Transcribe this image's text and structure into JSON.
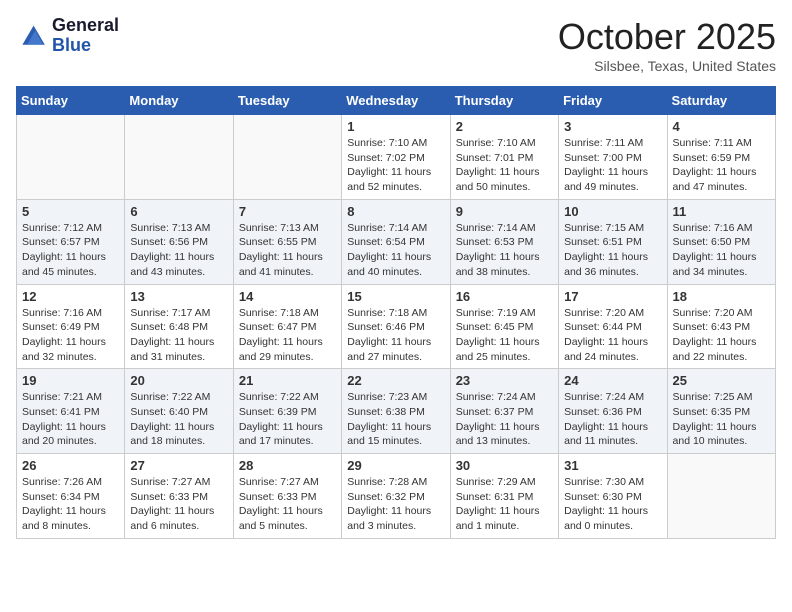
{
  "header": {
    "logo_line1": "General",
    "logo_line2": "Blue",
    "month_title": "October 2025",
    "location": "Silsbee, Texas, United States"
  },
  "days_of_week": [
    "Sunday",
    "Monday",
    "Tuesday",
    "Wednesday",
    "Thursday",
    "Friday",
    "Saturday"
  ],
  "weeks": [
    [
      {
        "day": "",
        "content": ""
      },
      {
        "day": "",
        "content": ""
      },
      {
        "day": "",
        "content": ""
      },
      {
        "day": "1",
        "content": "Sunrise: 7:10 AM\nSunset: 7:02 PM\nDaylight: 11 hours and 52 minutes."
      },
      {
        "day": "2",
        "content": "Sunrise: 7:10 AM\nSunset: 7:01 PM\nDaylight: 11 hours and 50 minutes."
      },
      {
        "day": "3",
        "content": "Sunrise: 7:11 AM\nSunset: 7:00 PM\nDaylight: 11 hours and 49 minutes."
      },
      {
        "day": "4",
        "content": "Sunrise: 7:11 AM\nSunset: 6:59 PM\nDaylight: 11 hours and 47 minutes."
      }
    ],
    [
      {
        "day": "5",
        "content": "Sunrise: 7:12 AM\nSunset: 6:57 PM\nDaylight: 11 hours and 45 minutes."
      },
      {
        "day": "6",
        "content": "Sunrise: 7:13 AM\nSunset: 6:56 PM\nDaylight: 11 hours and 43 minutes."
      },
      {
        "day": "7",
        "content": "Sunrise: 7:13 AM\nSunset: 6:55 PM\nDaylight: 11 hours and 41 minutes."
      },
      {
        "day": "8",
        "content": "Sunrise: 7:14 AM\nSunset: 6:54 PM\nDaylight: 11 hours and 40 minutes."
      },
      {
        "day": "9",
        "content": "Sunrise: 7:14 AM\nSunset: 6:53 PM\nDaylight: 11 hours and 38 minutes."
      },
      {
        "day": "10",
        "content": "Sunrise: 7:15 AM\nSunset: 6:51 PM\nDaylight: 11 hours and 36 minutes."
      },
      {
        "day": "11",
        "content": "Sunrise: 7:16 AM\nSunset: 6:50 PM\nDaylight: 11 hours and 34 minutes."
      }
    ],
    [
      {
        "day": "12",
        "content": "Sunrise: 7:16 AM\nSunset: 6:49 PM\nDaylight: 11 hours and 32 minutes."
      },
      {
        "day": "13",
        "content": "Sunrise: 7:17 AM\nSunset: 6:48 PM\nDaylight: 11 hours and 31 minutes."
      },
      {
        "day": "14",
        "content": "Sunrise: 7:18 AM\nSunset: 6:47 PM\nDaylight: 11 hours and 29 minutes."
      },
      {
        "day": "15",
        "content": "Sunrise: 7:18 AM\nSunset: 6:46 PM\nDaylight: 11 hours and 27 minutes."
      },
      {
        "day": "16",
        "content": "Sunrise: 7:19 AM\nSunset: 6:45 PM\nDaylight: 11 hours and 25 minutes."
      },
      {
        "day": "17",
        "content": "Sunrise: 7:20 AM\nSunset: 6:44 PM\nDaylight: 11 hours and 24 minutes."
      },
      {
        "day": "18",
        "content": "Sunrise: 7:20 AM\nSunset: 6:43 PM\nDaylight: 11 hours and 22 minutes."
      }
    ],
    [
      {
        "day": "19",
        "content": "Sunrise: 7:21 AM\nSunset: 6:41 PM\nDaylight: 11 hours and 20 minutes."
      },
      {
        "day": "20",
        "content": "Sunrise: 7:22 AM\nSunset: 6:40 PM\nDaylight: 11 hours and 18 minutes."
      },
      {
        "day": "21",
        "content": "Sunrise: 7:22 AM\nSunset: 6:39 PM\nDaylight: 11 hours and 17 minutes."
      },
      {
        "day": "22",
        "content": "Sunrise: 7:23 AM\nSunset: 6:38 PM\nDaylight: 11 hours and 15 minutes."
      },
      {
        "day": "23",
        "content": "Sunrise: 7:24 AM\nSunset: 6:37 PM\nDaylight: 11 hours and 13 minutes."
      },
      {
        "day": "24",
        "content": "Sunrise: 7:24 AM\nSunset: 6:36 PM\nDaylight: 11 hours and 11 minutes."
      },
      {
        "day": "25",
        "content": "Sunrise: 7:25 AM\nSunset: 6:35 PM\nDaylight: 11 hours and 10 minutes."
      }
    ],
    [
      {
        "day": "26",
        "content": "Sunrise: 7:26 AM\nSunset: 6:34 PM\nDaylight: 11 hours and 8 minutes."
      },
      {
        "day": "27",
        "content": "Sunrise: 7:27 AM\nSunset: 6:33 PM\nDaylight: 11 hours and 6 minutes."
      },
      {
        "day": "28",
        "content": "Sunrise: 7:27 AM\nSunset: 6:33 PM\nDaylight: 11 hours and 5 minutes."
      },
      {
        "day": "29",
        "content": "Sunrise: 7:28 AM\nSunset: 6:32 PM\nDaylight: 11 hours and 3 minutes."
      },
      {
        "day": "30",
        "content": "Sunrise: 7:29 AM\nSunset: 6:31 PM\nDaylight: 11 hours and 1 minute."
      },
      {
        "day": "31",
        "content": "Sunrise: 7:30 AM\nSunset: 6:30 PM\nDaylight: 11 hours and 0 minutes."
      },
      {
        "day": "",
        "content": ""
      }
    ]
  ]
}
